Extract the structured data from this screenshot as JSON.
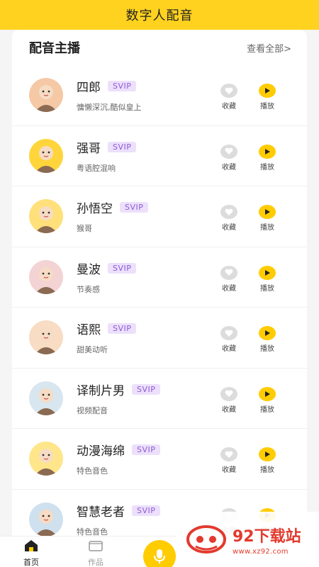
{
  "header": {
    "title": "数字人配音"
  },
  "section": {
    "title": "配音主播",
    "view_all": "查看全部>"
  },
  "actions": {
    "favorite_label": "收藏",
    "play_label": "播放"
  },
  "anchors": [
    {
      "name": "四郎",
      "badge": "SVIP",
      "desc": "慵懒深沉,酷似皇上",
      "avatar": "emperor-avatar",
      "avatar_color": "#f5c8a6"
    },
    {
      "name": "强哥",
      "badge": "SVIP",
      "desc": "粤语腔混响",
      "avatar": "man-cap-avatar",
      "avatar_color": "#ffd53b"
    },
    {
      "name": "孙悟空",
      "badge": "SVIP",
      "desc": "猴哥",
      "avatar": "monkey-king-avatar",
      "avatar_color": "#ffe07a"
    },
    {
      "name": "曼波",
      "badge": "SVIP",
      "desc": "节奏感",
      "avatar": "girl-avatar",
      "avatar_color": "#f3d3d3"
    },
    {
      "name": "语熙",
      "badge": "SVIP",
      "desc": "甜美动听",
      "avatar": "woman-avatar",
      "avatar_color": "#f8dcc3"
    },
    {
      "name": "译制片男",
      "badge": "SVIP",
      "desc": "视频配音",
      "avatar": "glasses-man-avatar",
      "avatar_color": "#d8e6f0"
    },
    {
      "name": "动漫海绵",
      "badge": "SVIP",
      "desc": "特色音色",
      "avatar": "sponge-avatar",
      "avatar_color": "#ffe68a"
    },
    {
      "name": "智慧老者",
      "badge": "SVIP",
      "desc": "特色音色",
      "avatar": "elder-avatar",
      "avatar_color": "#cfe0ee"
    }
  ],
  "nav": {
    "home_label": "首页",
    "works_label": "作品"
  },
  "watermark": {
    "brand": "92下载站",
    "url": "www.xz92.com"
  },
  "colors": {
    "accent": "#ffd21f",
    "play": "#ffcc00",
    "svip_text": "#8f5bd8",
    "svip_bg": "#ece0fb",
    "watermark": "#e23a2e"
  }
}
